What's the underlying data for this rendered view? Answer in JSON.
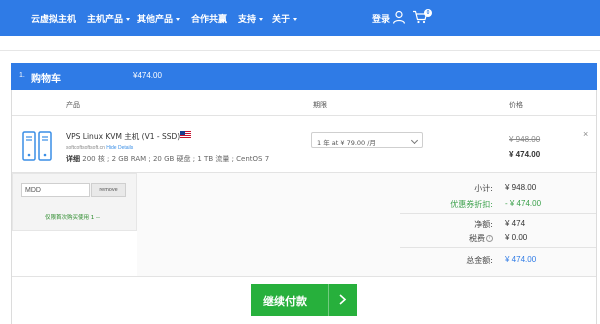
{
  "nav": {
    "items": [
      "云虚拟主机",
      "主机产品",
      "其他产品",
      "合作共赢",
      "支持",
      "关于"
    ],
    "login": "登录",
    "cart_count": "0"
  },
  "cart": {
    "step": "1.",
    "title": "购物车",
    "header_total": "¥474.00",
    "col_product": "产品",
    "col_cycle": "期限",
    "col_price": "价格"
  },
  "product": {
    "name": "VPS Linux KVM 主机 (V1 - SSD)",
    "hostname": "softcoftsoftsoft.cn",
    "hide_details": "Hide Details",
    "spec_prefix": "详细",
    "spec_rest": "200 核 ; 2 GB RAM ; 20 GB 硬盘 ; 1 TB 流量 ; CentOS 7",
    "cycle_selected": "1 年 at ¥ 79.00 /月",
    "price_old": "¥ 948.00",
    "price_new": "¥ 474.00",
    "remove": "×"
  },
  "promo": {
    "value": "MDD",
    "remove_label": "remove",
    "note": "仅限首次购买使用 1 --"
  },
  "summary": {
    "subtotal_label": "小计:",
    "subtotal": "¥ 948.00",
    "discount_label": "优惠券折扣:",
    "discount": "- ¥ 474.00",
    "net_label": "净额:",
    "net": "¥ 474",
    "tax_label": "税费",
    "tax": "¥ 0.00",
    "total_label": "总金额:",
    "total": "¥ 474.00"
  },
  "checkout": {
    "label": "继续付款"
  },
  "colors": {
    "brand_blue": "#2f7be6",
    "checkout_green": "#27b03c",
    "discount_green": "#3aa04a"
  }
}
